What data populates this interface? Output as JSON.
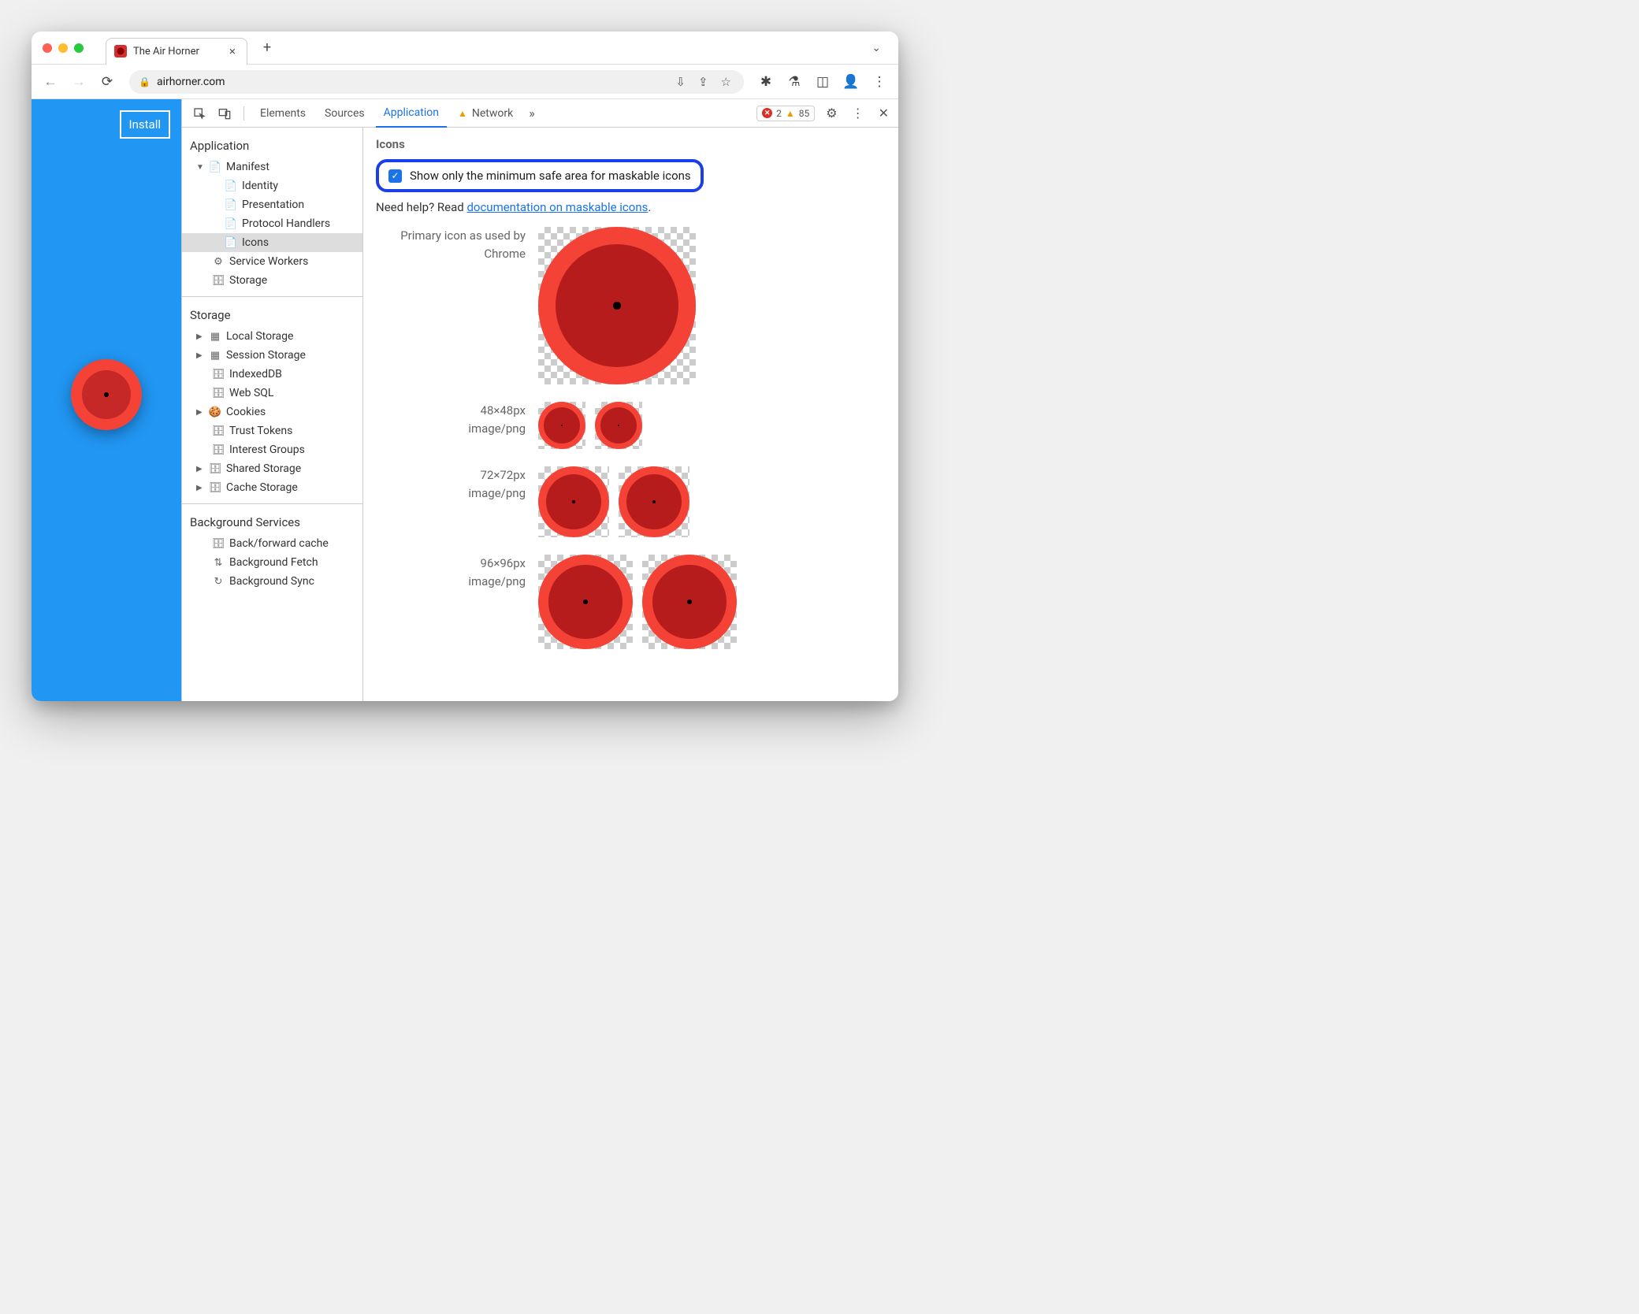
{
  "browser": {
    "tab_title": "The Air Horner",
    "url": "airhorner.com"
  },
  "page": {
    "install_label": "Install"
  },
  "devtools": {
    "tabs": {
      "elements": "Elements",
      "sources": "Sources",
      "application": "Application",
      "network": "Network"
    },
    "errors": "2",
    "warnings": "85"
  },
  "sidebar": {
    "application": "Application",
    "manifest": "Manifest",
    "identity": "Identity",
    "presentation": "Presentation",
    "protocol_handlers": "Protocol Handlers",
    "icons": "Icons",
    "service_workers": "Service Workers",
    "storage_app": "Storage",
    "storage_head": "Storage",
    "local_storage": "Local Storage",
    "session_storage": "Session Storage",
    "indexeddb": "IndexedDB",
    "web_sql": "Web SQL",
    "cookies": "Cookies",
    "trust_tokens": "Trust Tokens",
    "interest_groups": "Interest Groups",
    "shared_storage": "Shared Storage",
    "cache_storage": "Cache Storage",
    "bg_services": "Background Services",
    "bf_cache": "Back/forward cache",
    "bg_fetch": "Background Fetch",
    "bg_sync": "Background Sync"
  },
  "main": {
    "title": "Icons",
    "checkbox_label": "Show only the minimum safe area for maskable icons",
    "help_prefix": "Need help? Read ",
    "help_link": "documentation on maskable icons",
    "help_suffix": ".",
    "primary_label1": "Primary icon as used by",
    "primary_label2": "Chrome",
    "row48_size": "48×48px",
    "row48_mime": "image/png",
    "row72_size": "72×72px",
    "row72_mime": "image/png",
    "row96_size": "96×96px",
    "row96_mime": "image/png"
  }
}
